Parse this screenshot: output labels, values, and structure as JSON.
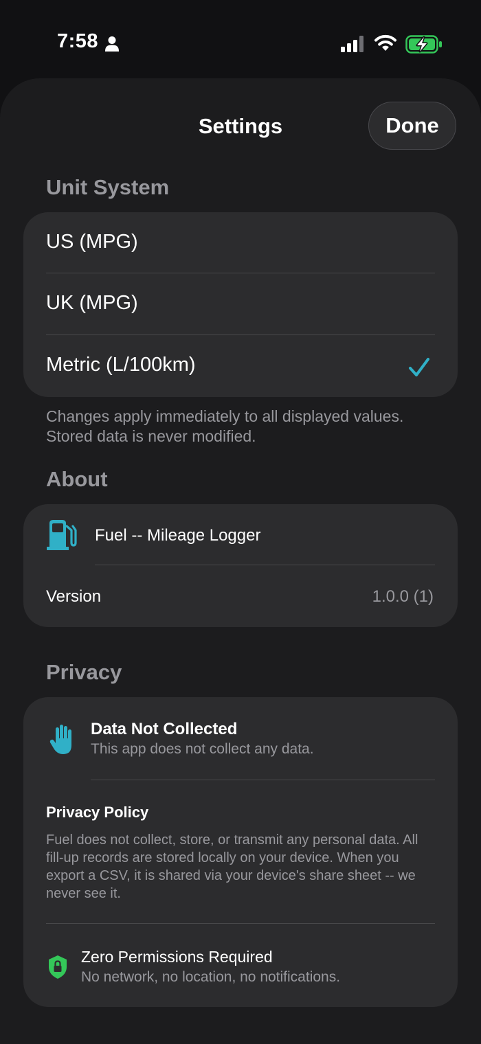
{
  "status_bar": {
    "time": "7:58",
    "icons": [
      "person-icon",
      "signal-icon",
      "wifi-icon",
      "battery-charging-icon"
    ]
  },
  "nav": {
    "title": "Settings",
    "done_label": "Done"
  },
  "unit_system": {
    "header": "Unit System",
    "options": [
      {
        "label": "US (MPG)",
        "selected": false
      },
      {
        "label": "UK (MPG)",
        "selected": false
      },
      {
        "label": "Metric (L/100km)",
        "selected": true
      }
    ],
    "footnote": "Changes apply immediately to all displayed values. Stored data is never modified."
  },
  "about": {
    "header": "About",
    "app_name": "Fuel -- Mileage Logger",
    "version_label": "Version",
    "version_value": "1.0.0 (1)"
  },
  "privacy": {
    "header": "Privacy",
    "data_not_collected_title": "Data Not Collected",
    "data_not_collected_subtitle": "This app does not collect any data.",
    "policy_title": "Privacy Policy",
    "policy_body": "Fuel does not collect, store, or transmit any personal data. All fill-up records are stored locally on your device. When you export a CSV, it is shared via your device's share sheet -- we never see it.",
    "zero_permissions_title": "Zero Permissions Required",
    "zero_permissions_subtitle": "No network, no location, no notifications."
  },
  "colors": {
    "accent": "#30b0c7",
    "shield": "#34c759",
    "background": "#1c1c1e",
    "card": "#2c2c2e",
    "secondary_text": "#98989d"
  }
}
